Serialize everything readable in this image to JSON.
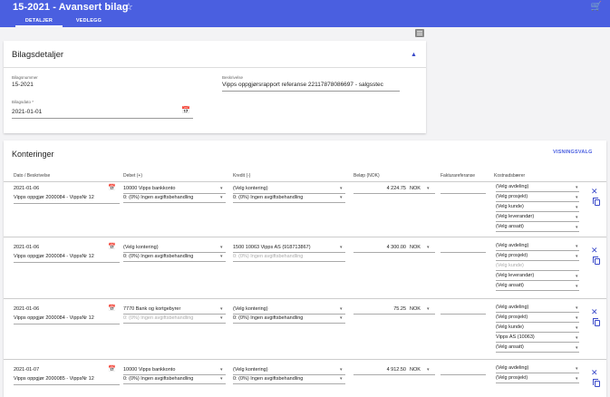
{
  "header": {
    "title": "15-2021 - Avansert bilag",
    "tabs": [
      "DETALJER",
      "VEDLEGG"
    ]
  },
  "bilagsdetaljer": {
    "title": "Bilagsdetaljer",
    "bilagsnummer_label": "Bilagsnummer",
    "bilagsnummer": "15-2021",
    "beskrivelse_label": "Beskrivelse",
    "beskrivelse": "Vipps oppgjørsrapport referanse 22117878086697 - salgsstec",
    "bilagsdato_label": "Bilagsdato *",
    "bilagsdato": "2021-01-01"
  },
  "konteringer": {
    "title": "Konteringer",
    "visningsvalg": "VISNINGSVALG",
    "columns": [
      "Dato / Beskrivelse",
      "Debet (+)",
      "Kredit (-)",
      "Beløp (NOK)",
      "Fakturareferanse",
      "Kostnadsbærer"
    ],
    "rows": [
      {
        "dato": "2021-01-06",
        "beskrivelse": "Vipps oppgjør 2000084 - VippsNr 12",
        "debet": "10000 Vipps bankkonto",
        "debet_mva": "0: (0%) Ingen avgiftsbehandling",
        "kredit": "(Velg kontering)",
        "kredit_mva": "0: (0%) Ingen avgiftsbehandling",
        "belop": "4 224.75",
        "valuta": "NOK",
        "kostnad": [
          "(Velg avdeling)",
          "(Velg prosjekt)",
          "(Velg kunde)",
          "(Velg leverandør)",
          "(Velg ansatt)"
        ]
      },
      {
        "dato": "2021-01-06",
        "beskrivelse": "Vipps oppgjør 2000084 - VippsNr 12",
        "debet": "(Velg kontering)",
        "debet_mva": "0: (0%) Ingen avgiftsbehandling",
        "kredit": "1500 10063 Vipps AS (918713867)",
        "kredit_mva": "0: (0%) Ingen avgiftsbehandling",
        "belop": "4 300.00",
        "valuta": "NOK",
        "kostnad": [
          "(Velg avdeling)",
          "(Velg prosjekt)",
          "(Velg kunde)",
          "(Velg leverandør)",
          "(Velg ansatt)"
        ]
      },
      {
        "dato": "2021-01-06",
        "beskrivelse": "Vipps oppgjør 2000084 - VippsNr 12",
        "debet": "7770 Bank og kortgebyrer",
        "debet_mva": "0: (0%) Ingen avgiftsbehandling",
        "kredit": "(Velg kontering)",
        "kredit_mva": "0: (0%) Ingen avgiftsbehandling",
        "belop": "75.25",
        "valuta": "NOK",
        "kostnad": [
          "(Velg avdeling)",
          "(Velg prosjekt)",
          "(Velg kunde)",
          "Vipps AS (10063)",
          "(Velg ansatt)"
        ]
      },
      {
        "dato": "2021-01-07",
        "beskrivelse": "Vipps oppgjør 2000085 - VippsNr 12",
        "debet": "10000 Vipps bankkonto",
        "debet_mva": "0: (0%) Ingen avgiftsbehandling",
        "kredit": "(Velg kontering)",
        "kredit_mva": "0: (0%) Ingen avgiftsbehandling",
        "belop": "4 912.50",
        "valuta": "NOK",
        "kostnad": [
          "(Velg avdeling)",
          "(Velg prosjekt)"
        ]
      }
    ]
  },
  "colors": {
    "primary": "#4a5fe0",
    "accent": "#3949c9"
  },
  "icons": [
    "star-icon",
    "cart-icon",
    "chevron-up-icon",
    "calendar-icon",
    "close-icon",
    "copy-icon",
    "note-icon"
  ]
}
